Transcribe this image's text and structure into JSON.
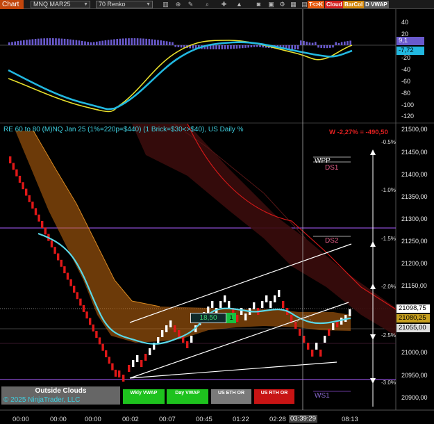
{
  "toolbar": {
    "chart_label": "Chart",
    "instrument": "MNQ MAR25",
    "bar_type": "70 Renko",
    "pills": [
      {
        "label": "T<>K",
        "color": "#e65a0e"
      },
      {
        "label": "Cloud",
        "color": "#d42020"
      },
      {
        "label": "BarCol",
        "color": "#d2860a"
      },
      {
        "label": "D VWAP",
        "color": "#5a5a5a"
      }
    ]
  },
  "osc_axis": {
    "ticks": [
      "40",
      "20",
      "-20",
      "-40",
      "-60",
      "-80",
      "-100",
      "-120"
    ],
    "tag_top": "9,1",
    "tag_bottom": "-7,72",
    "tag_top_color": "#6a5acd",
    "tag_bottom_color": "#22b8e0"
  },
  "main": {
    "title": "RE 60 to 80 (M)NQ Jan 25 (1%=220p=$440) (1 Brick=$30<>$40), US Daily %",
    "weekly_pl": "W -2,27% = -490,50",
    "levels": {
      "wpp": "WPP",
      "ds1": "DS1",
      "ds2": "DS2",
      "ws1": "WS1"
    },
    "pct_labels": [
      "-0.5%",
      "-1.0%",
      "-1.5%",
      "-2.0%",
      "-2.5%",
      "-3.0%"
    ],
    "box_value": "18,50",
    "box_small": "1",
    "watermark_title": "Outside Clouds",
    "copyright": "© 2025 NinjaTrader, LLC",
    "buttons": [
      {
        "label": "Wkly VWAP",
        "color": "#1ec21e"
      },
      {
        "label": "Day VWAP",
        "color": "#1ec21e"
      },
      {
        "label": "US ETH OR",
        "color": "#7a7a7a"
      },
      {
        "label": "US RTH OR",
        "color": "#c81414"
      }
    ]
  },
  "price_axis": {
    "ticks": [
      "21500,00",
      "21450,00",
      "21400,00",
      "21350,00",
      "21300,00",
      "21250,00",
      "21200,00",
      "21150,00",
      "21100,00",
      "21050,00",
      "21000,00",
      "20950,00",
      "20900,00"
    ],
    "tag_last": "21098,75",
    "tag_mid": "21080,25",
    "tag_low": "21055,00"
  },
  "time_axis": {
    "labels": [
      "00:00",
      "00:00",
      "00:00",
      "00:02",
      "00:07",
      "00:45",
      "01:22",
      "02:28",
      "03:39:29",
      "08:13"
    ]
  }
}
